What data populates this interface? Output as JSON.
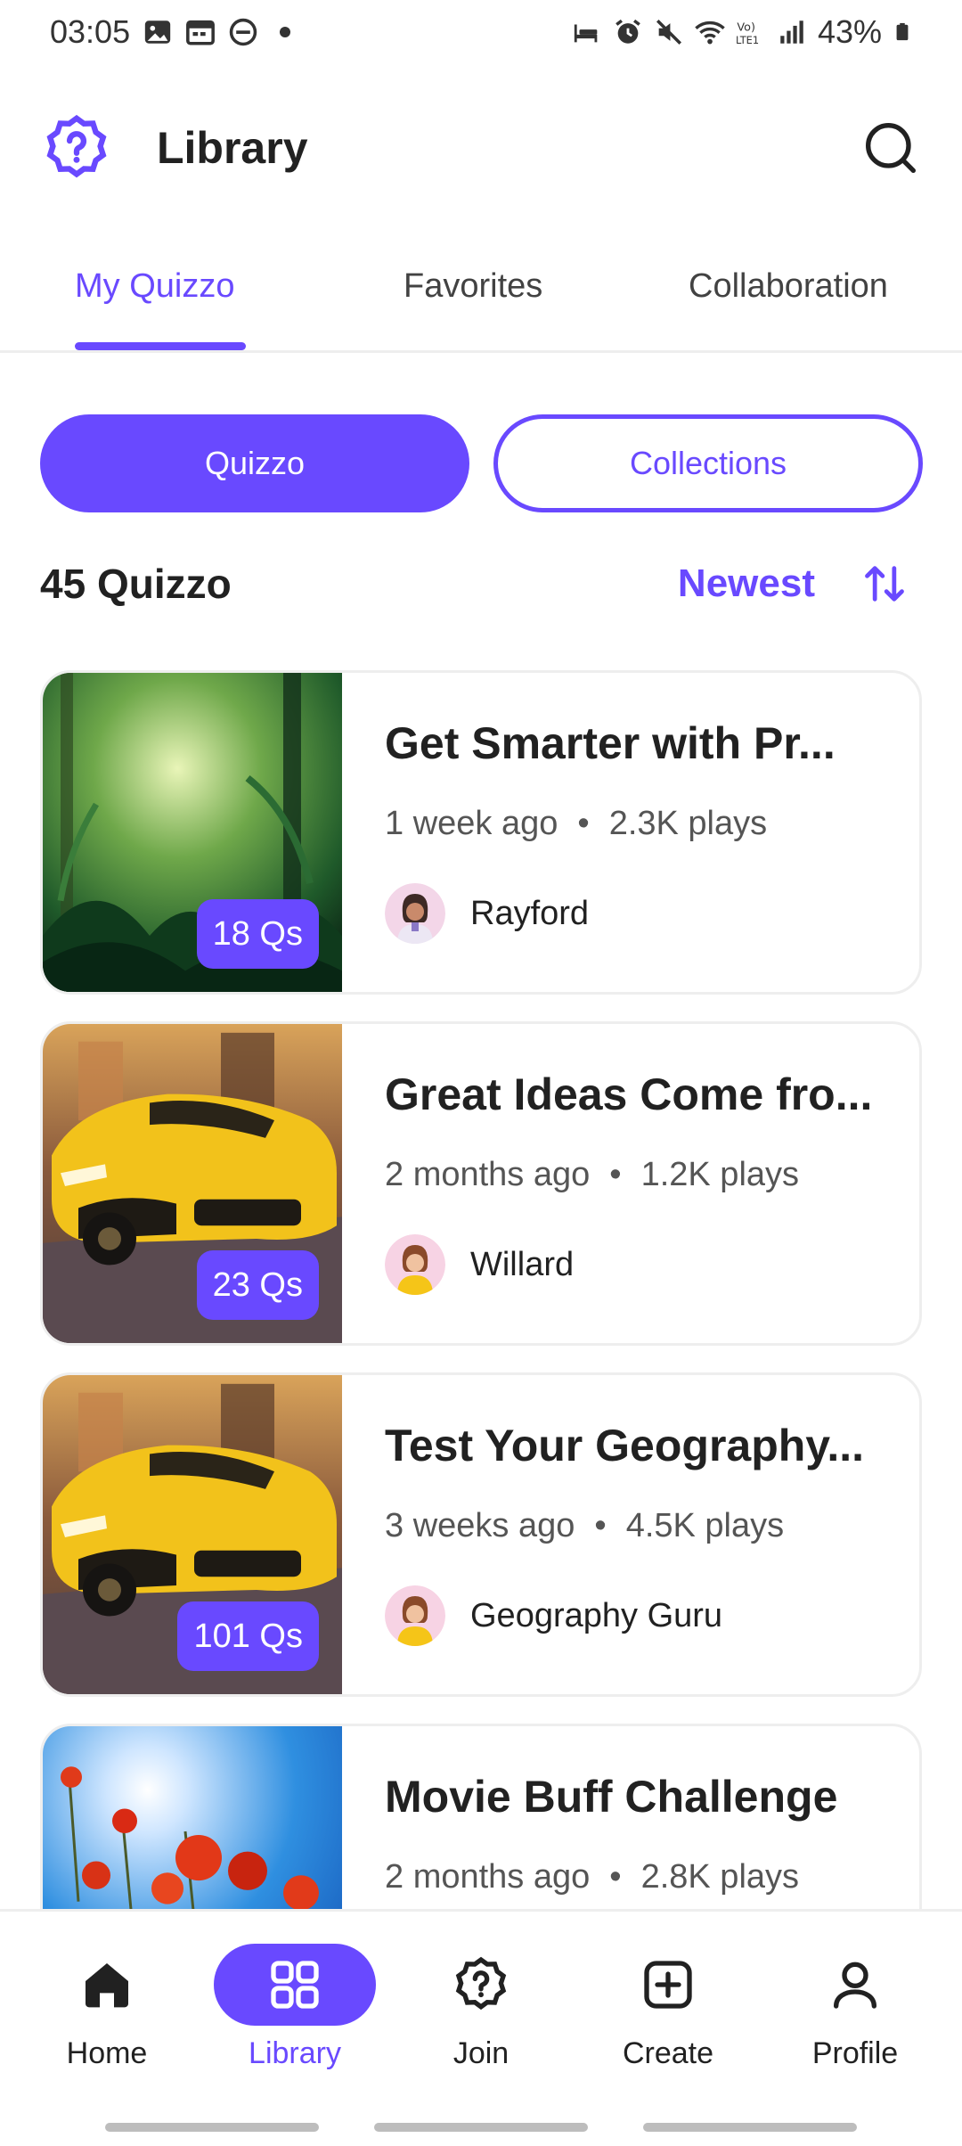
{
  "status_bar": {
    "time": "03:05",
    "battery": "43%",
    "icons_left": [
      "image-icon",
      "calendar-icon",
      "dnd-icon",
      "dot-icon"
    ],
    "icons_right": [
      "sleep-icon",
      "alarm-icon",
      "mute-icon",
      "wifi-icon",
      "volte-icon",
      "signal-icon",
      "battery-icon"
    ]
  },
  "header": {
    "title": "Library",
    "logo_icon": "quiz-logo-icon",
    "search_icon": "search-icon"
  },
  "tabs": [
    {
      "label": "My Quizzo",
      "active": true
    },
    {
      "label": "Favorites",
      "active": false
    },
    {
      "label": "Collaboration",
      "active": false
    }
  ],
  "segment": {
    "quizzo_label": "Quizzo",
    "collections_label": "Collections",
    "selected": "Quizzo"
  },
  "list_header": {
    "count_label": "45 Quizzo",
    "sort_label": "Newest",
    "sort_icon": "sort-arrows-icon"
  },
  "quizzes": [
    {
      "title": "Get Smarter with Pr...",
      "time": "1 week ago",
      "plays": "2.3K plays",
      "author": "Rayford",
      "qs": "18 Qs",
      "thumb": "forest"
    },
    {
      "title": "Great Ideas Come fro...",
      "time": "2 months ago",
      "plays": "1.2K plays",
      "author": "Willard",
      "qs": "23 Qs",
      "thumb": "car"
    },
    {
      "title": "Test Your Geography...",
      "time": "3 weeks ago",
      "plays": "4.5K plays",
      "author": "Geography Guru",
      "qs": "101 Qs",
      "thumb": "car"
    },
    {
      "title": "Movie Buff Challenge",
      "time": "2 months ago",
      "plays": "2.8K plays",
      "author": "",
      "qs": "",
      "thumb": "flowers"
    }
  ],
  "bottom_nav": [
    {
      "label": "Home",
      "icon": "home-icon",
      "active": false
    },
    {
      "label": "Library",
      "icon": "grid-icon",
      "active": true
    },
    {
      "label": "Join",
      "icon": "quiz-badge-icon",
      "active": false
    },
    {
      "label": "Create",
      "icon": "plus-square-icon",
      "active": false
    },
    {
      "label": "Profile",
      "icon": "user-icon",
      "active": false
    }
  ],
  "colors": {
    "accent": "#6949FF",
    "text": "#212121",
    "muted": "#555555",
    "border": "#EEEEEE"
  }
}
